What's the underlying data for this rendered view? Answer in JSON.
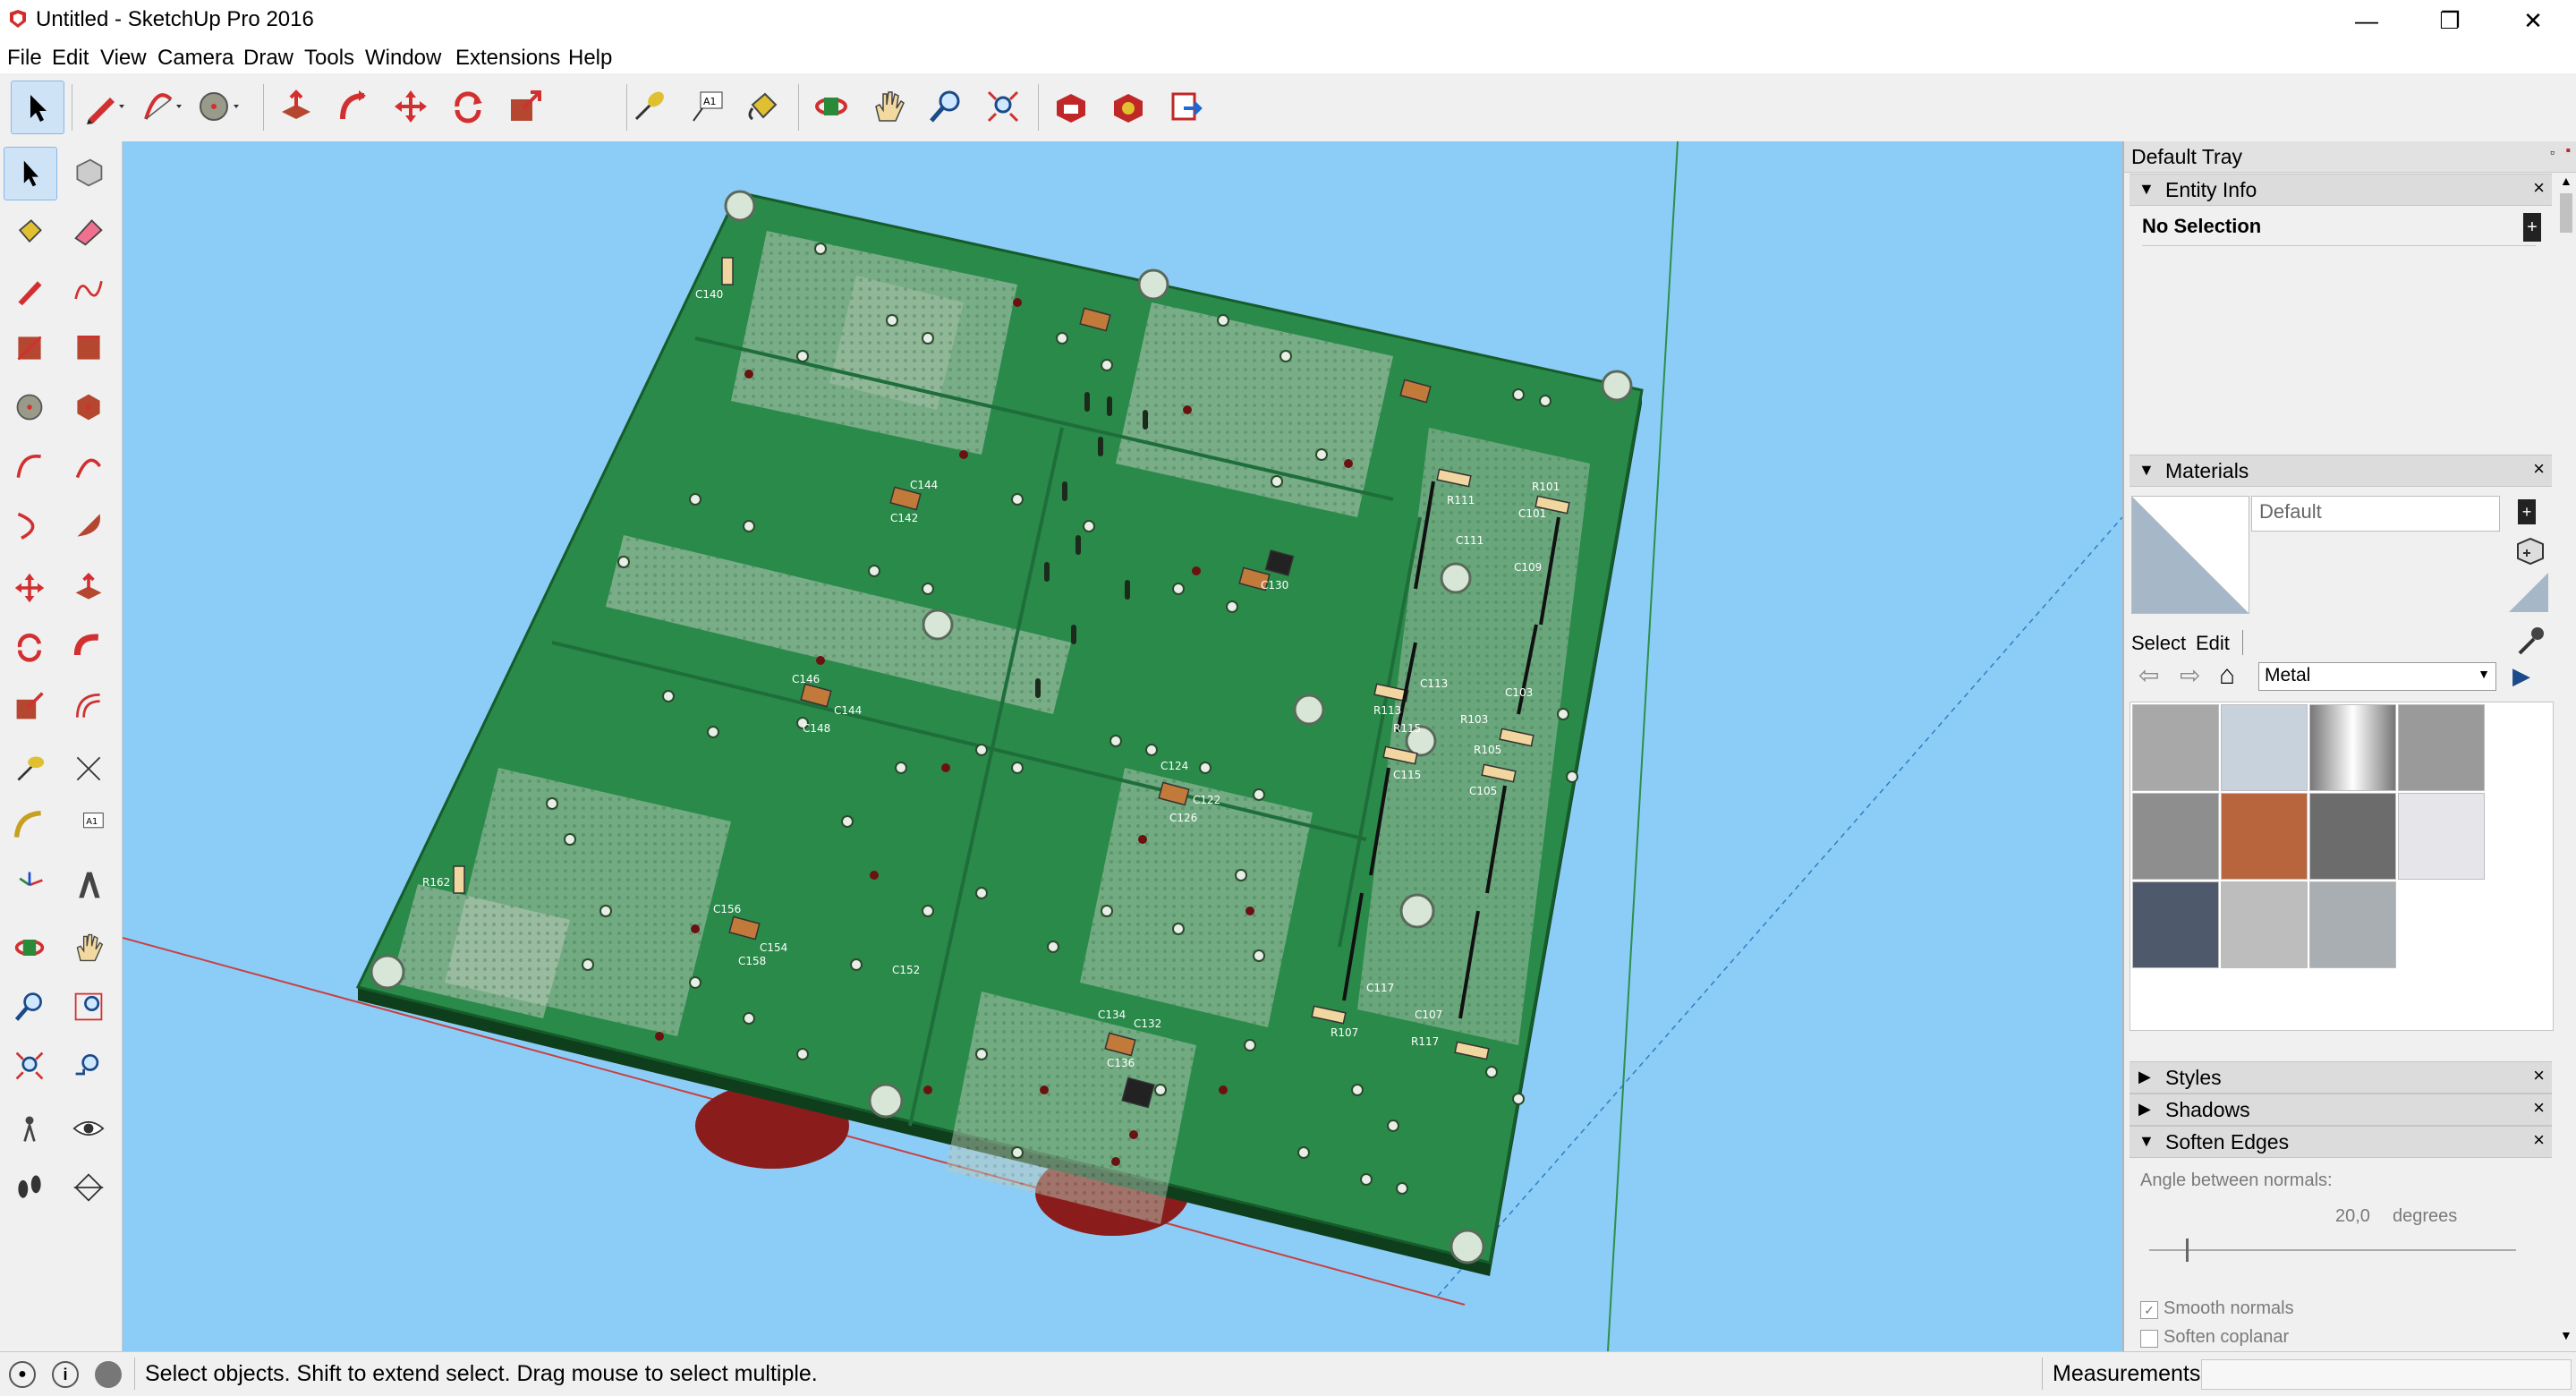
{
  "window": {
    "title": "Untitled - SketchUp Pro 2016",
    "controls": {
      "minimize": "—",
      "restore": "❐",
      "close": "✕"
    }
  },
  "menu": [
    "File",
    "Edit",
    "View",
    "Camera",
    "Draw",
    "Tools",
    "Window",
    "Extensions",
    "Help"
  ],
  "toolbar": {
    "tools": [
      "select",
      "pencil",
      "arc",
      "circle",
      "push-pull",
      "follow-me",
      "move",
      "rotate",
      "scale",
      "tape-measure",
      "text",
      "paint-bucket",
      "orbit",
      "pan",
      "zoom",
      "zoom-extents",
      "3d-warehouse",
      "extension-warehouse",
      "layout"
    ]
  },
  "left_tools": [
    "select",
    "make-component",
    "paint-bucket",
    "eraser",
    "line",
    "freehand",
    "rectangle",
    "rotated-rectangle",
    "circle",
    "polygon",
    "arc",
    "pie",
    "2-point-arc",
    "3-point-arc",
    "move",
    "push-pull",
    "rotate",
    "follow-me",
    "scale",
    "offset",
    "tape-measure",
    "dimension",
    "protractor",
    "text",
    "axes",
    "3d-text",
    "orbit",
    "pan",
    "zoom",
    "zoom-window",
    "zoom-extents",
    "previous",
    "position-camera",
    "look-around",
    "walk",
    "section-plane"
  ],
  "viewport": {
    "board_labels": [
      "C140",
      "R162",
      "C152",
      "C156",
      "C154",
      "C158",
      "C146",
      "C144",
      "C148",
      "C142",
      "C144",
      "C130",
      "C124",
      "C122",
      "C126",
      "C134",
      "C132",
      "C136",
      "R111",
      "R113",
      "C113",
      "R115",
      "C115",
      "R117",
      "C117",
      "R107",
      "C107",
      "C101",
      "R101",
      "R103",
      "C103",
      "R105",
      "C105",
      "C109",
      "C111"
    ],
    "colors": {
      "sky": "#8ccdf8",
      "board": "#2a8a4a",
      "board_edge": "#165c2b",
      "copper": "#b9c9b9"
    }
  },
  "tray": {
    "title": "Default Tray",
    "entity_info": {
      "label": "Entity Info",
      "selection": "No Selection"
    },
    "materials": {
      "label": "Materials",
      "name_field": "Default",
      "tabs": [
        "Select",
        "Edit"
      ],
      "category": "Metal",
      "swatches": [
        "#a8a8a8",
        "#c8d2dc",
        "#d8d8d8",
        "#9a9a9a",
        "#8e8e8e",
        "#b8653e",
        "#6c6c6c",
        "#e6e6ea",
        "#4e5a6c",
        "#bdbdbd",
        "#a8aeb2"
      ]
    },
    "styles": {
      "label": "Styles"
    },
    "shadows": {
      "label": "Shadows"
    },
    "soften_edges": {
      "label": "Soften Edges",
      "angle_label": "Angle between normals:",
      "angle_value": "20,0",
      "angle_unit": "degrees",
      "slider_fraction": 0.1,
      "smooth_normals": {
        "label": "Smooth normals",
        "checked": true
      },
      "soften_coplanar": {
        "label": "Soften coplanar",
        "checked": false
      }
    }
  },
  "status": {
    "message": "Select objects. Shift to extend select. Drag mouse to select multiple.",
    "measurements_label": "Measurements"
  }
}
